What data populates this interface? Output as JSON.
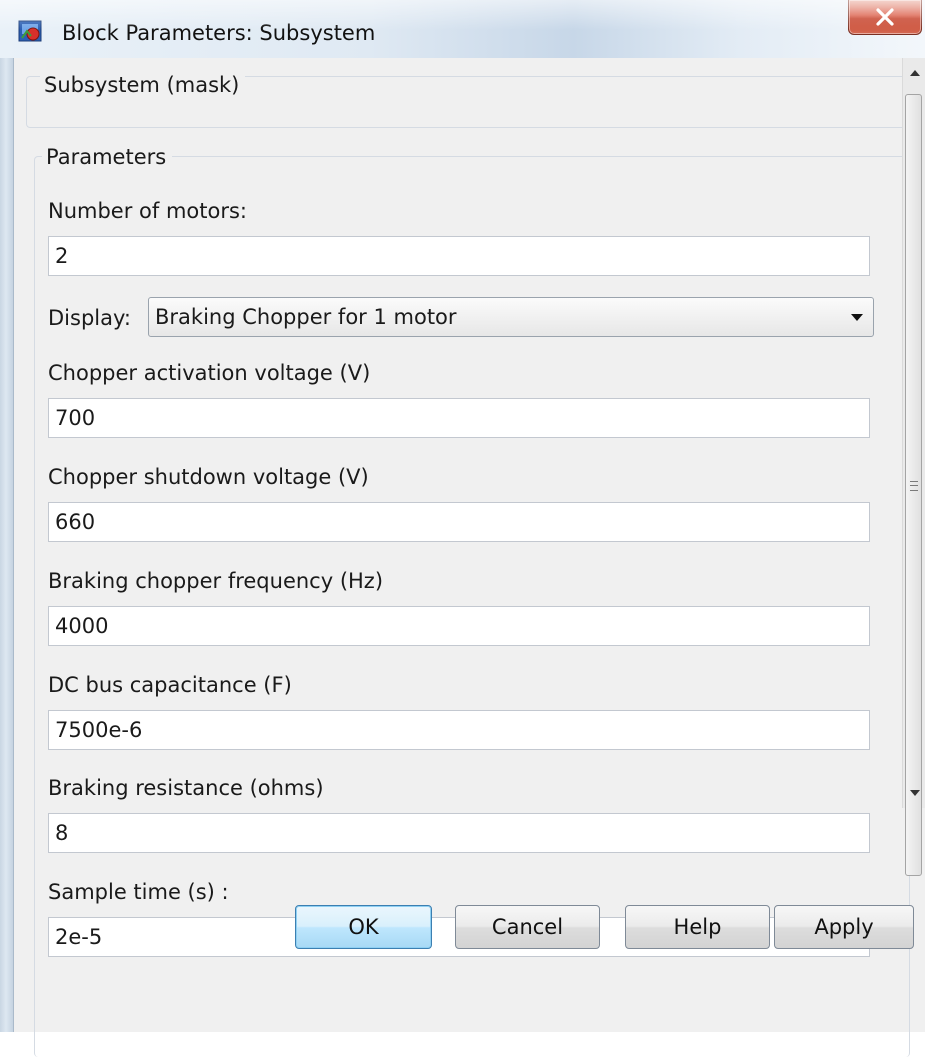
{
  "window": {
    "title": "Block Parameters: Subsystem",
    "app_icon": "simulink-block-icon",
    "close_icon": "close-x-icon"
  },
  "mask_group": {
    "legend": "Subsystem (mask)"
  },
  "params_group": {
    "legend": "Parameters",
    "number_of_motors": {
      "label": "Number of motors:",
      "value": "2"
    },
    "display": {
      "label": "Display:",
      "selected": "Braking Chopper for 1 motor"
    },
    "fields": [
      {
        "label": "Chopper activation voltage (V)",
        "value": "700"
      },
      {
        "label": "Chopper shutdown voltage (V)",
        "value": "660"
      },
      {
        "label": "Braking chopper frequency (Hz)",
        "value": "4000"
      },
      {
        "label": "DC bus capacitance (F)",
        "value": "7500e-6"
      },
      {
        "label": "Braking resistance (ohms)",
        "value": "8"
      },
      {
        "label": "Sample time (s) :",
        "value": "2e-5"
      }
    ]
  },
  "buttons": {
    "ok": "OK",
    "cancel": "Cancel",
    "help": "Help",
    "apply": "Apply"
  },
  "scrollbar": {
    "up_icon": "scroll-up-arrow-icon",
    "down_icon": "scroll-down-arrow-icon"
  }
}
